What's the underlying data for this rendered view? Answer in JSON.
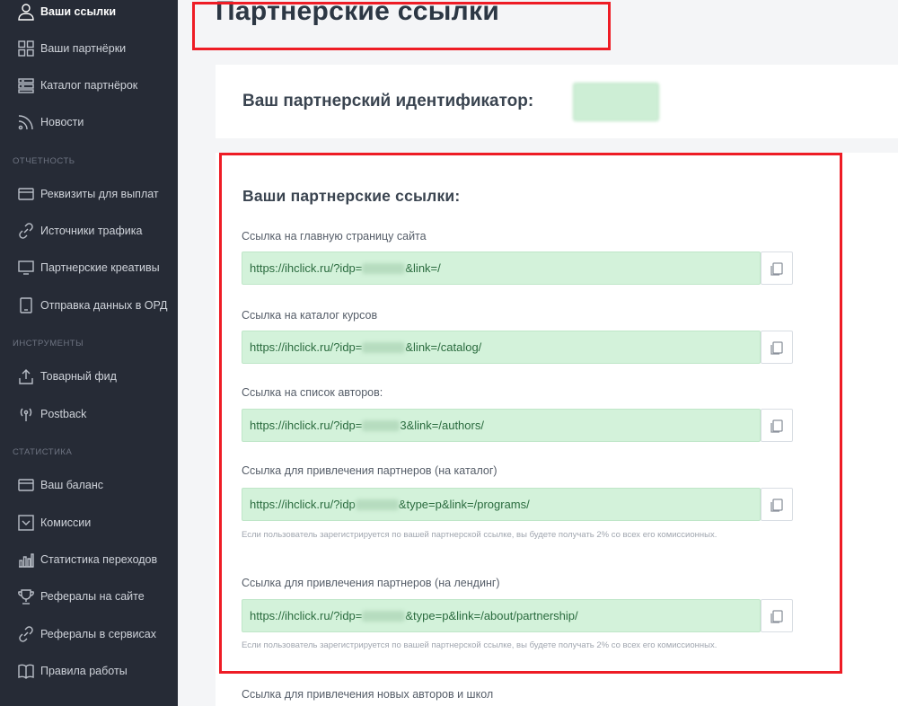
{
  "sidebar": {
    "items": [
      {
        "label": "Ваши ссылки",
        "icon": "user-icon",
        "active": true
      },
      {
        "label": "Ваши партнёрки",
        "icon": "grid-icon"
      },
      {
        "label": "Каталог партнёрок",
        "icon": "catalog-icon"
      },
      {
        "label": "Новости",
        "icon": "rss-icon"
      }
    ],
    "section_reports": "ОТЧЕТНОСТЬ",
    "reports": [
      {
        "label": "Реквизиты для выплат",
        "icon": "card-icon"
      },
      {
        "label": "Источники трафика",
        "icon": "link-icon"
      },
      {
        "label": "Партнерские креативы",
        "icon": "monitor-icon"
      },
      {
        "label": "Отправка данных в ОРД",
        "icon": "tablet-icon"
      }
    ],
    "section_tools": "ИНСТРУМЕНТЫ",
    "tools": [
      {
        "label": "Товарный фид",
        "icon": "upload-icon"
      },
      {
        "label": "Postback",
        "icon": "broadcast-icon"
      }
    ],
    "section_stats": "СТАТИСТИКА",
    "stats": [
      {
        "label": "Ваш баланс",
        "icon": "wallet-icon"
      },
      {
        "label": "Комиссии",
        "icon": "chevron-box-icon"
      },
      {
        "label": "Статистика переходов",
        "icon": "bar-chart-icon"
      },
      {
        "label": "Рефералы на сайте",
        "icon": "trophy-icon"
      },
      {
        "label": "Рефералы в сервисах",
        "icon": "link-icon"
      },
      {
        "label": "Правила работы",
        "icon": "book-icon"
      }
    ]
  },
  "page": {
    "title": "Партнерские ссылки",
    "id_label": "Ваш партнерский идентификатор:",
    "id_value": "",
    "links_title": "Ваши партнерские ссылки:"
  },
  "links": [
    {
      "label": "Ссылка на главную страницу сайта",
      "prefix": "https://ihclick.ru/?idp=",
      "suffix": "&link=/"
    },
    {
      "label": "Ссылка на каталог курсов",
      "prefix": "https://ihclick.ru/?idp=",
      "suffix": "&link=/catalog/"
    },
    {
      "label": "Ссылка на список авторов:",
      "prefix": "https://ihclick.ru/?idp=",
      "suffix": "3&link=/authors/"
    },
    {
      "label": "Ссылка для привлечения партнеров (на каталог)",
      "prefix": "https://ihclick.ru/?idp",
      "suffix": "&type=p&link=/programs/",
      "hint": "Если пользователь зарегистрируется по вашей партнерской ссылке, вы будете получать 2% со всех его комиссионных."
    },
    {
      "label": "Ссылка для привлечения партнеров (на лендинг)",
      "prefix": "https://ihclick.ru/?idp=",
      "suffix": "&type=p&link=/about/partnership/",
      "hint": "Если пользователь зарегистрируется по вашей партнерской ссылке, вы будете получать 2% со всех его комиссионных."
    }
  ],
  "next_label": "Ссылка для привлечения новых авторов и школ"
}
